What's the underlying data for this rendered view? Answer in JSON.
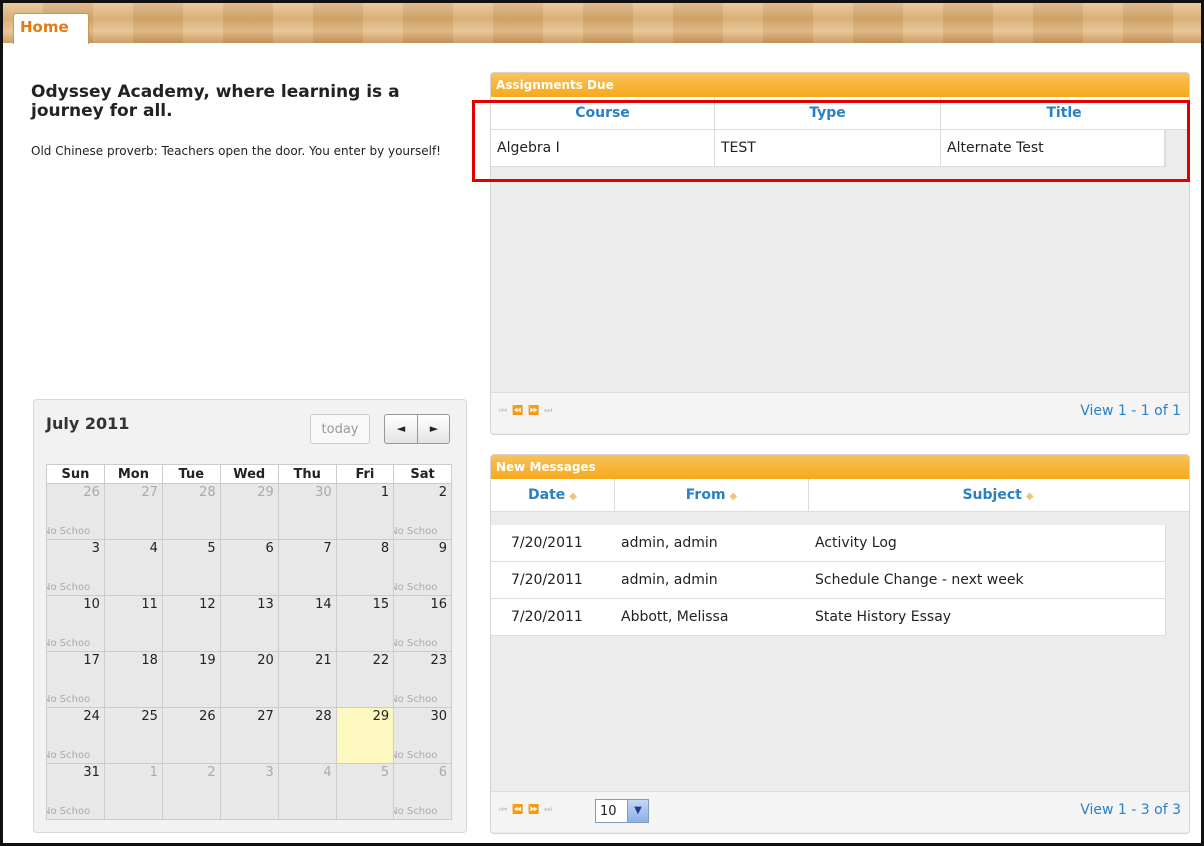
{
  "tabs": [
    {
      "label": "Home",
      "active": true
    }
  ],
  "intro": {
    "title": "Odyssey Academy, where learning is a journey for all.",
    "quote": "Old Chinese proverb: Teachers open the door. You enter by yourself!"
  },
  "assignments": {
    "title": "Assignments Due",
    "columns": [
      "Course",
      "Type",
      "Title"
    ],
    "rows": [
      [
        "Algebra I",
        "TEST",
        "Alternate Test"
      ]
    ],
    "pager_arrows": "⏮ ⏪ ⏩ ⏭",
    "view_count": "View 1 - 1 of 1"
  },
  "messages": {
    "title": "New Messages",
    "columns": [
      "Date",
      "From",
      "Subject"
    ],
    "sort_icon": "sort-icon",
    "rows": [
      [
        "7/20/2011",
        "admin, admin",
        "Activity Log"
      ],
      [
        "7/20/2011",
        "admin, admin",
        "Schedule Change - next week"
      ],
      [
        "7/20/2011",
        "Abbott, Melissa",
        "State History Essay"
      ]
    ],
    "pager_arrows": "⏮ ⏪ ⏩ ⏭",
    "page_size": "10",
    "view_count": "View 1 - 3 of 3"
  },
  "calendar": {
    "title": "July 2011",
    "today_label": "today",
    "prev_label": "◄",
    "next_label": "►",
    "weekdays": [
      "Sun",
      "Mon",
      "Tue",
      "Wed",
      "Thu",
      "Fri",
      "Sat"
    ],
    "weeks": [
      [
        {
          "d": "26",
          "other": true,
          "ev": "No Schoo"
        },
        {
          "d": "27",
          "other": true
        },
        {
          "d": "28",
          "other": true
        },
        {
          "d": "29",
          "other": true
        },
        {
          "d": "30",
          "other": true
        },
        {
          "d": "1"
        },
        {
          "d": "2",
          "ev": "No Schoo"
        }
      ],
      [
        {
          "d": "3",
          "ev": "No Schoo"
        },
        {
          "d": "4"
        },
        {
          "d": "5"
        },
        {
          "d": "6"
        },
        {
          "d": "7"
        },
        {
          "d": "8"
        },
        {
          "d": "9",
          "ev": "No Schoo"
        }
      ],
      [
        {
          "d": "10",
          "ev": "No Schoo"
        },
        {
          "d": "11"
        },
        {
          "d": "12"
        },
        {
          "d": "13"
        },
        {
          "d": "14"
        },
        {
          "d": "15"
        },
        {
          "d": "16",
          "ev": "No Schoo"
        }
      ],
      [
        {
          "d": "17",
          "ev": "No Schoo"
        },
        {
          "d": "18"
        },
        {
          "d": "19"
        },
        {
          "d": "20"
        },
        {
          "d": "21"
        },
        {
          "d": "22"
        },
        {
          "d": "23",
          "ev": "No Schoo"
        }
      ],
      [
        {
          "d": "24",
          "ev": "No Schoo"
        },
        {
          "d": "25"
        },
        {
          "d": "26"
        },
        {
          "d": "27"
        },
        {
          "d": "28"
        },
        {
          "d": "29",
          "today": true
        },
        {
          "d": "30",
          "ev": "No Schoo"
        }
      ],
      [
        {
          "d": "31",
          "ev": "No Schoo"
        },
        {
          "d": "1",
          "other": true
        },
        {
          "d": "2",
          "other": true
        },
        {
          "d": "3",
          "other": true
        },
        {
          "d": "4",
          "other": true
        },
        {
          "d": "5",
          "other": true
        },
        {
          "d": "6",
          "other": true,
          "ev": "No Schoo"
        }
      ]
    ]
  },
  "colors": {
    "accent": "#f6a91b",
    "link": "#2a80c8",
    "highlight": "#e00000",
    "today_bg": "#fcf8c0"
  }
}
